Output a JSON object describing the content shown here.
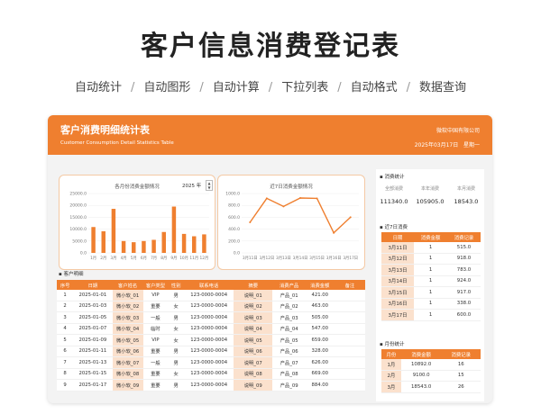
{
  "page": {
    "title": "客户信息消费登记表",
    "features": [
      "自动统计",
      "自动图形",
      "自动计算",
      "下拉列表",
      "自动格式",
      "数据查询"
    ]
  },
  "header": {
    "title": "客户消费明细统计表",
    "subtitle": "Customer Consumption Detail Statistics Table",
    "company": "微软中国有限公司",
    "date": "2025年03月17日",
    "weekday": "星期一"
  },
  "monthly_chart_panel": {
    "year_value": "2025",
    "year_unit": "年"
  },
  "chart_data": [
    {
      "type": "bar",
      "title": "各月份消费金额情况",
      "categories": [
        "1月",
        "2月",
        "3月",
        "4月",
        "5月",
        "6月",
        "7月",
        "8月",
        "9月",
        "10月",
        "11月",
        "12月"
      ],
      "values": [
        10892.0,
        9100.0,
        18543.0,
        5000.0,
        4500.0,
        5000.0,
        5500.0,
        8800.0,
        19500.0,
        8000.0,
        7000.0,
        7800.0
      ],
      "ylim": [
        0,
        25000
      ],
      "yticks": [
        "0.0",
        "5000.0",
        "10000.0",
        "15000.0",
        "20000.0",
        "25000.0"
      ],
      "color": "#ef7f2f"
    },
    {
      "type": "line",
      "title": "近7日消费金额情况",
      "categories": [
        "3月11日",
        "3月12日",
        "3月13日",
        "3月14日",
        "3月15日",
        "3月16日",
        "3月17日"
      ],
      "values": [
        515.0,
        918.0,
        783.0,
        924.0,
        917.0,
        338.0,
        600.0
      ],
      "ylim": [
        0,
        1000
      ],
      "yticks": [
        "0.0",
        "200.0",
        "400.0",
        "600.0",
        "800.0",
        "1000.0"
      ],
      "color": "#ef7f2f"
    }
  ],
  "detail": {
    "section_label": "客户明细",
    "columns": [
      "序号",
      "日期",
      "客户姓名",
      "客户类型",
      "性别",
      "联系电话",
      "摘要",
      "消费产品",
      "消费金额",
      "备注"
    ],
    "rows": [
      [
        "1",
        "2025-01-01",
        "微小软_01",
        "VIP",
        "男",
        "123-0000-0004",
        "说明_01",
        "产品_01",
        "421.00",
        ""
      ],
      [
        "2",
        "2025-01-03",
        "微小软_02",
        "重要",
        "女",
        "123-0000-0004",
        "说明_02",
        "产品_02",
        "463.00",
        ""
      ],
      [
        "3",
        "2025-01-05",
        "微小软_03",
        "一般",
        "男",
        "123-0000-0004",
        "说明_03",
        "产品_03",
        "505.00",
        ""
      ],
      [
        "4",
        "2025-01-07",
        "微小软_04",
        "临时",
        "女",
        "123-0000-0004",
        "说明_04",
        "产品_04",
        "547.00",
        ""
      ],
      [
        "5",
        "2025-01-09",
        "微小软_05",
        "VIP",
        "女",
        "123-0000-0004",
        "说明_05",
        "产品_05",
        "659.00",
        ""
      ],
      [
        "6",
        "2025-01-11",
        "微小软_06",
        "重要",
        "男",
        "123-0000-0004",
        "说明_06",
        "产品_06",
        "328.00",
        ""
      ],
      [
        "7",
        "2025-01-13",
        "微小软_07",
        "一般",
        "男",
        "123-0000-0004",
        "说明_07",
        "产品_07",
        "626.00",
        ""
      ],
      [
        "8",
        "2025-01-15",
        "微小软_08",
        "重要",
        "女",
        "123-0000-0004",
        "说明_08",
        "产品_08",
        "669.00",
        ""
      ],
      [
        "9",
        "2025-01-17",
        "微小软_09",
        "重要",
        "男",
        "123-0000-0004",
        "说明_09",
        "产品_09",
        "884.00",
        ""
      ]
    ]
  },
  "sidebar": {
    "stats_label": "消费统计",
    "stats": [
      {
        "label": "全部消费",
        "value": "111340.0"
      },
      {
        "label": "本年消费",
        "value": "105905.0"
      },
      {
        "label": "本月消费",
        "value": "18543.0"
      }
    ],
    "recent_label": "近7日消费",
    "recent_columns": [
      "日期",
      "消费金额",
      "消费记录"
    ],
    "recent_rows": [
      [
        "3月11日",
        "1",
        "515.0"
      ],
      [
        "3月12日",
        "1",
        "918.0"
      ],
      [
        "3月13日",
        "1",
        "783.0"
      ],
      [
        "3月14日",
        "1",
        "924.0"
      ],
      [
        "3月15日",
        "1",
        "917.0"
      ],
      [
        "3月16日",
        "1",
        "338.0"
      ],
      [
        "3月17日",
        "1",
        "600.0"
      ]
    ],
    "monthly_label": "月份统计",
    "monthly_columns": [
      "月份",
      "消费金额",
      "消费记录"
    ],
    "monthly_rows": [
      [
        "1月",
        "10892.0",
        "16"
      ],
      [
        "2月",
        "9100.0",
        "15"
      ],
      [
        "3月",
        "18543.0",
        "26"
      ]
    ]
  }
}
